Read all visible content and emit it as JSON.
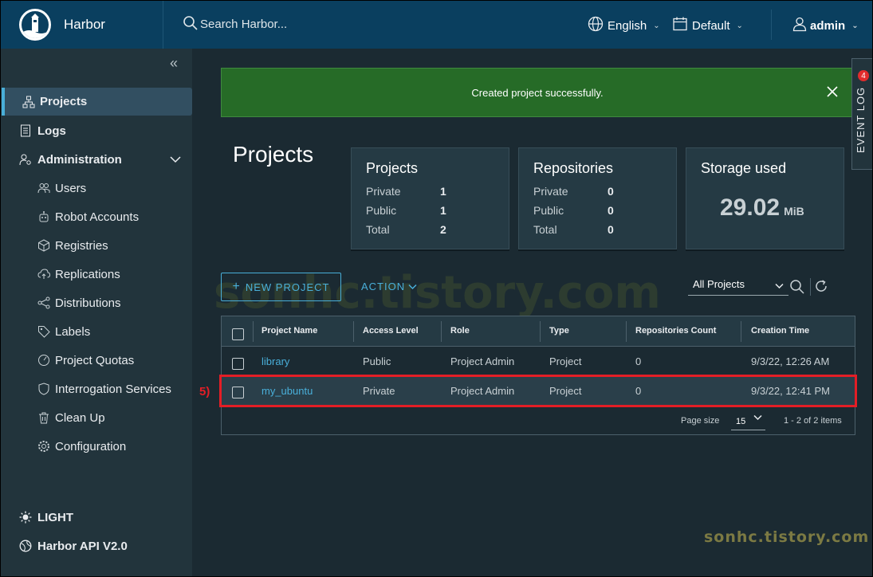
{
  "header": {
    "brand": "Harbor",
    "search_placeholder": "Search Harbor...",
    "language": "English",
    "theme": "Default",
    "user": "admin"
  },
  "sidebar": {
    "items": [
      {
        "label": "Projects",
        "icon": "projects-icon"
      },
      {
        "label": "Logs",
        "icon": "logs-icon"
      },
      {
        "label": "Administration",
        "icon": "administration-icon"
      },
      {
        "label": "Users",
        "icon": "users-icon"
      },
      {
        "label": "Robot Accounts",
        "icon": "robot-icon"
      },
      {
        "label": "Registries",
        "icon": "registries-icon"
      },
      {
        "label": "Replications",
        "icon": "replications-icon"
      },
      {
        "label": "Distributions",
        "icon": "distributions-icon"
      },
      {
        "label": "Labels",
        "icon": "labels-icon"
      },
      {
        "label": "Project Quotas",
        "icon": "quotas-icon"
      },
      {
        "label": "Interrogation Services",
        "icon": "shield-icon"
      },
      {
        "label": "Clean Up",
        "icon": "trash-icon"
      },
      {
        "label": "Configuration",
        "icon": "gear-icon"
      }
    ],
    "bottom": {
      "theme_toggle": "LIGHT",
      "api_link": "Harbor API V2.0"
    }
  },
  "alert": {
    "message": "Created project successfully."
  },
  "event_log": {
    "label": "EVENT LOG",
    "count": "4"
  },
  "page_title": "Projects",
  "cards": {
    "projects": {
      "title": "Projects",
      "rows": [
        {
          "label": "Private",
          "value": "1"
        },
        {
          "label": "Public",
          "value": "1"
        },
        {
          "label": "Total",
          "value": "2"
        }
      ]
    },
    "repositories": {
      "title": "Repositories",
      "rows": [
        {
          "label": "Private",
          "value": "0"
        },
        {
          "label": "Public",
          "value": "0"
        },
        {
          "label": "Total",
          "value": "0"
        }
      ]
    },
    "storage": {
      "title": "Storage used",
      "value": "29.02",
      "unit": "MiB"
    }
  },
  "toolbar": {
    "new_project": "NEW PROJECT",
    "action": "ACTION",
    "filter": "All Projects"
  },
  "table": {
    "columns": [
      "Project Name",
      "Access Level",
      "Role",
      "Type",
      "Repositories Count",
      "Creation Time"
    ],
    "rows": [
      [
        "library",
        "Public",
        "Project Admin",
        "Project",
        "0",
        "9/3/22, 12:26 AM"
      ],
      [
        "my_ubuntu",
        "Private",
        "Project Admin",
        "Project",
        "0",
        "9/3/22, 12:41 PM"
      ]
    ],
    "page_size_label": "Page size",
    "page_size": "15",
    "range": "1 - 2 of 2 items"
  },
  "annotation": {
    "step": "5)"
  },
  "watermark": "sonhc.tistory.com",
  "colors": {
    "header": "#0a3f5f",
    "accent": "#49afd9",
    "alert": "#266b27",
    "highlight": "#e41e26"
  }
}
